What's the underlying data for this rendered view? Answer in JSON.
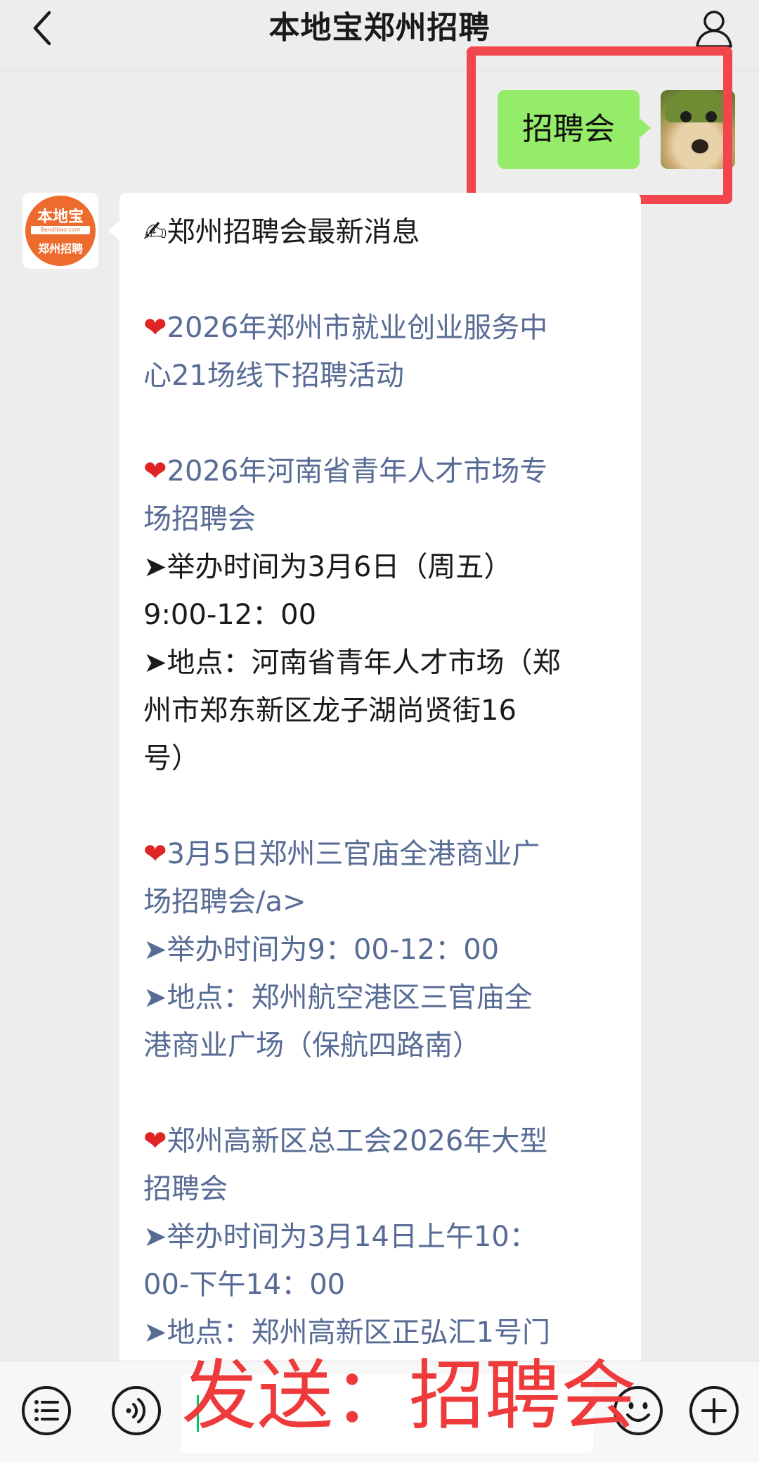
{
  "header": {
    "title": "本地宝郑州招聘"
  },
  "user_message": {
    "text": "招聘会"
  },
  "bot_avatar": {
    "logo_top": "本地宝",
    "logo_url": "Bendibao.com",
    "logo_bottom": "郑州招聘"
  },
  "bot_message": {
    "lines": [
      "✍郑州招聘会最新消息",
      "",
      "2026年郑州市就业创业服务中",
      "心21场线下招聘活动",
      "",
      "2026年河南省青年人才市场专",
      "场招聘会",
      "➤举办时间为3月6日（周五）",
      "9:00-12：00",
      "➤地点：河南省青年人才市场（郑",
      "州市郑东新区龙子湖尚贤街16",
      "号）",
      "",
      "3月5日郑州三官庙全港商业广",
      "场招聘会/a>",
      "➤举办时间为9：00-12：00",
      "➤地点：郑州航空港区三官庙全",
      "港商业广场（保航四路南）",
      "",
      "郑州高新区总工会2026年大型",
      "招聘会",
      "➤举办时间为3月14日上午10：",
      "00-下午14：00",
      "➤地点：郑州高新区正弘汇1号门"
    ]
  },
  "heart_glyph": "❤",
  "overlay": {
    "text": "发送：招聘会"
  },
  "colors": {
    "background": "#ededed",
    "user_bubble": "#95ec69",
    "link_text": "#576b95",
    "highlight_frame": "#f2464d",
    "overlay_text": "#ee3a3a"
  },
  "icons": [
    "back-arrow-icon",
    "profile-icon",
    "menu-list-icon",
    "voice-icon",
    "emoji-icon",
    "plus-icon"
  ]
}
